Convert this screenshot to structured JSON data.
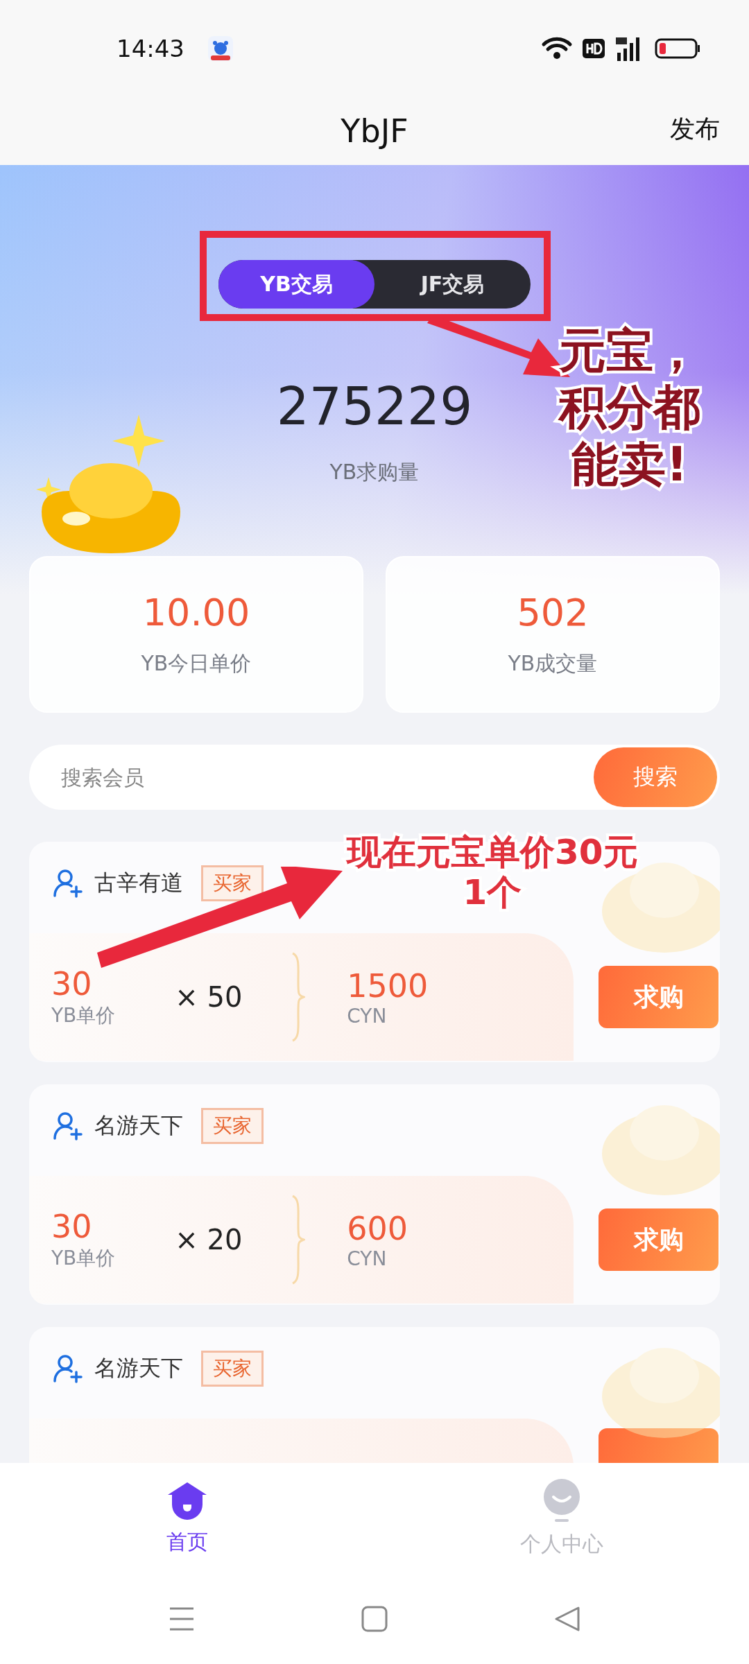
{
  "status_bar": {
    "time": "14:43"
  },
  "header": {
    "title": "YbJF",
    "action": "发布"
  },
  "tabs": [
    {
      "label": "YB交易",
      "selected": true
    },
    {
      "label": "JF交易",
      "selected": false
    }
  ],
  "summary": {
    "value": "275229",
    "label": "YB求购量"
  },
  "stats": [
    {
      "value": "10.00",
      "label": "YB今日单价"
    },
    {
      "value": "502",
      "label": "YB成交量"
    }
  ],
  "search": {
    "placeholder": "搜索会员",
    "button": "搜索"
  },
  "orders": [
    {
      "name": "古辛有道",
      "tag": "买家",
      "price": "30",
      "price_label": "YB单价",
      "quantity": "× 50",
      "total": "1500",
      "currency": "CYN",
      "button": "求购"
    },
    {
      "name": "名游天下",
      "tag": "买家",
      "price": "30",
      "price_label": "YB单价",
      "quantity": "× 20",
      "total": "600",
      "currency": "CYN",
      "button": "求购"
    },
    {
      "name": "名游天下",
      "tag": "买家"
    }
  ],
  "bottom_nav": [
    {
      "label": "首页",
      "kind": "home",
      "selected": true
    },
    {
      "label": "个人中心",
      "kind": "profile",
      "selected": false
    }
  ],
  "annotations": [
    {
      "lines": [
        "元宝，",
        "积分都",
        "能卖!"
      ]
    },
    {
      "lines": [
        "现在元宝单价30元",
        "1个"
      ]
    }
  ]
}
